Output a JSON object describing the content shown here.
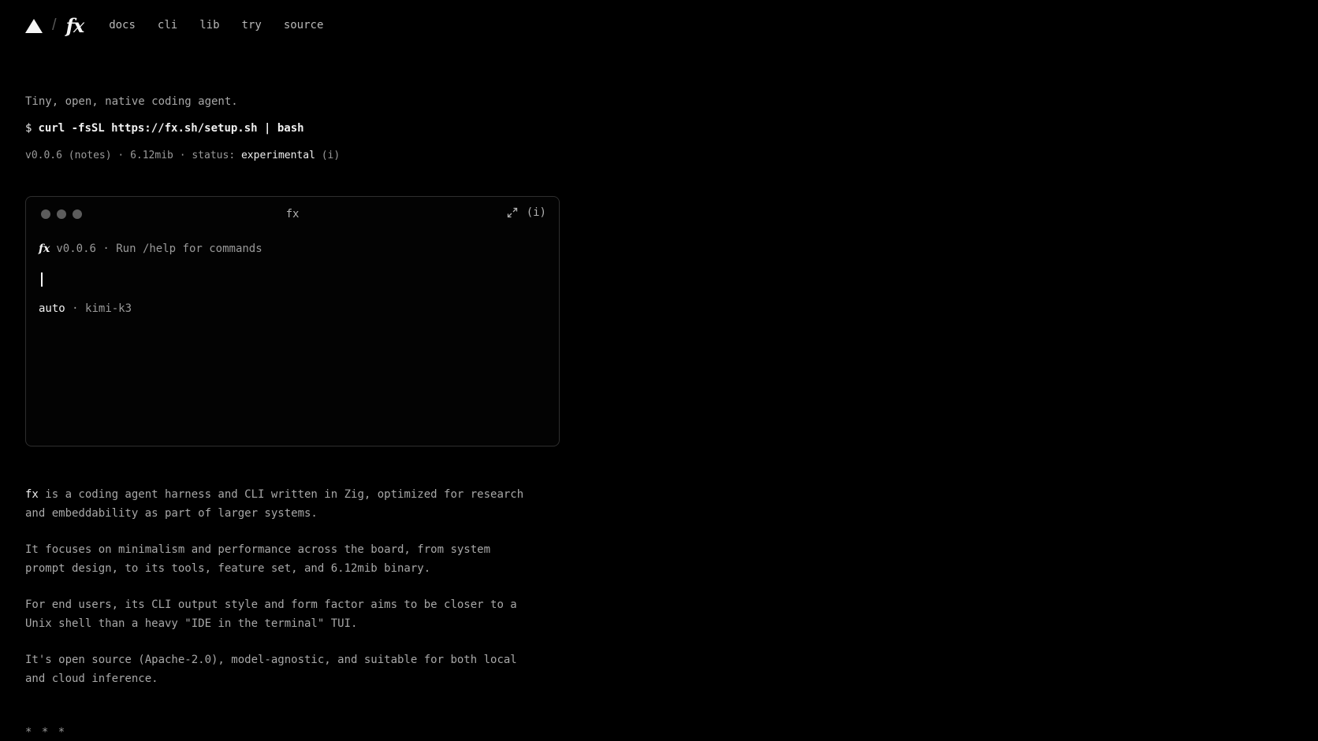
{
  "nav": {
    "slash": "/",
    "brand": "fx",
    "links": [
      "docs",
      "cli",
      "lib",
      "try",
      "source"
    ]
  },
  "hero": {
    "tagline": "Tiny, open, native coding agent.",
    "prompt": "$",
    "install_command": "curl -fsSL https://fx.sh/setup.sh | bash",
    "version": "v0.0.6",
    "notes": "(notes)",
    "sep": "·",
    "size": "6.12mib",
    "status_label": "status:",
    "status_value": "experimental",
    "info": "(i)"
  },
  "terminal": {
    "title": "fx",
    "info": "(i)",
    "brand": "fx",
    "banner": "v0.0.6 · Run /help for commands",
    "mode": "auto",
    "sep": "·",
    "model": "kimi-k3"
  },
  "description": {
    "p1_lead": "fx",
    "p1_rest": " is a coding agent harness and CLI written in Zig, optimized for research and embeddability as part of larger systems.",
    "p2": "It focuses on minimalism and performance across the board, from system prompt design, to its tools, feature set, and 6.12mib binary.",
    "p3": "For end users, its CLI output style and form factor aims to be closer to a Unix shell than a heavy \"IDE in the terminal\" TUI.",
    "p4": "It's open source (Apache-2.0), model-agnostic, and suitable for both local and cloud inference."
  },
  "separator": "* * *",
  "colors": {
    "background": "#000000",
    "text": "#a8a8a8",
    "bright": "#f0f0f0",
    "border": "#2e2e2e",
    "dot": "#5c5c5c"
  }
}
